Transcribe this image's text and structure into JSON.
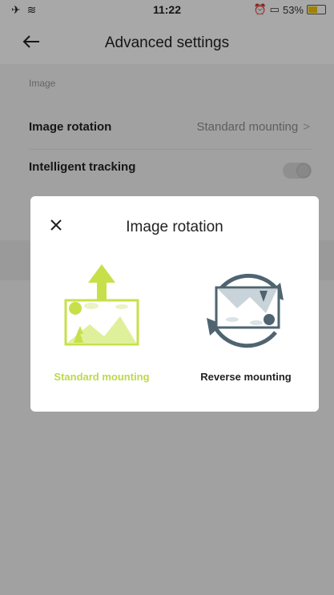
{
  "status_bar": {
    "left_icons": "✈ ≋",
    "time": "11:22",
    "battery_text": "53%",
    "battery_level": 0.53,
    "battery_color": "#f5c400"
  },
  "header": {
    "title": "Advanced settings",
    "back_icon": "back-arrow-icon"
  },
  "section": {
    "label": "Image"
  },
  "rows": {
    "rotation": {
      "label": "Image rotation",
      "value": "Standard mounting",
      "chevron": ">"
    },
    "tracking": {
      "label": "Intelligent tracking",
      "enabled": false
    }
  },
  "modal": {
    "title": "Image rotation",
    "close_icon": "close-icon",
    "options": {
      "standard": {
        "label": "Standard mounting",
        "selected": true,
        "icon": "standard-mounting-icon"
      },
      "reverse": {
        "label": "Reverse mounting",
        "selected": false,
        "icon": "reverse-mounting-icon"
      }
    }
  },
  "colors": {
    "accent": "#bcd94c",
    "icon_dark": "#4f6470",
    "overlay": "rgba(0,0,0,0.34)"
  }
}
